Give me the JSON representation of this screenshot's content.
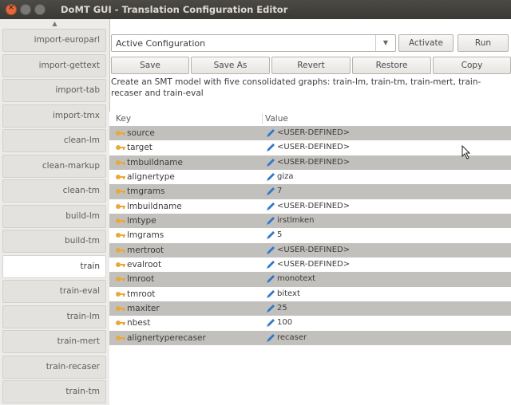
{
  "window": {
    "title": "DoMT GUI - Translation Configuration Editor"
  },
  "sidebar": {
    "items": [
      {
        "label": "import-europarl"
      },
      {
        "label": "import-gettext"
      },
      {
        "label": "import-tab"
      },
      {
        "label": "import-tmx"
      },
      {
        "label": "clean-lm"
      },
      {
        "label": "clean-markup"
      },
      {
        "label": "clean-tm"
      },
      {
        "label": "build-lm"
      },
      {
        "label": "build-tm"
      },
      {
        "label": "train"
      },
      {
        "label": "train-eval"
      },
      {
        "label": "train-lm"
      },
      {
        "label": "train-mert"
      },
      {
        "label": "train-recaser"
      },
      {
        "label": "train-tm"
      }
    ],
    "active_index": 9
  },
  "toolbar": {
    "config_value": "Active Configuration",
    "activate": "Activate",
    "run": "Run",
    "save": "Save",
    "save_as": "Save As",
    "revert": "Revert",
    "restore": "Restore",
    "copy": "Copy"
  },
  "description": "Create an SMT model with five consolidated graphs: train-lm, train-tm, train-mert, train-recaser and train-eval",
  "table": {
    "headers": {
      "key": "Key",
      "value": "Value"
    },
    "rows": [
      {
        "key": "source",
        "value": "<USER-DEFINED>"
      },
      {
        "key": "target",
        "value": "<USER-DEFINED>"
      },
      {
        "key": "tmbuildname",
        "value": "<USER-DEFINED>"
      },
      {
        "key": "alignertype",
        "value": "giza"
      },
      {
        "key": "tmgrams",
        "value": "7"
      },
      {
        "key": "lmbuildname",
        "value": "<USER-DEFINED>"
      },
      {
        "key": "lmtype",
        "value": "irstlmken"
      },
      {
        "key": "lmgrams",
        "value": "5"
      },
      {
        "key": "mertroot",
        "value": "<USER-DEFINED>"
      },
      {
        "key": "evalroot",
        "value": "<USER-DEFINED>"
      },
      {
        "key": "lmroot",
        "value": "monotext"
      },
      {
        "key": "tmroot",
        "value": "bitext"
      },
      {
        "key": "maxiter",
        "value": "25"
      },
      {
        "key": "nbest",
        "value": "100"
      },
      {
        "key": "alignertyperecaser",
        "value": "recaser"
      }
    ]
  },
  "colors": {
    "row_alt": "#c2c0bd",
    "pen_icon": "#2f78c8",
    "key_icon": "#e8a93a",
    "close_button": "#e6683a"
  },
  "icons": {
    "row_key": "key-icon",
    "row_value": "edit-pencil-icon"
  }
}
